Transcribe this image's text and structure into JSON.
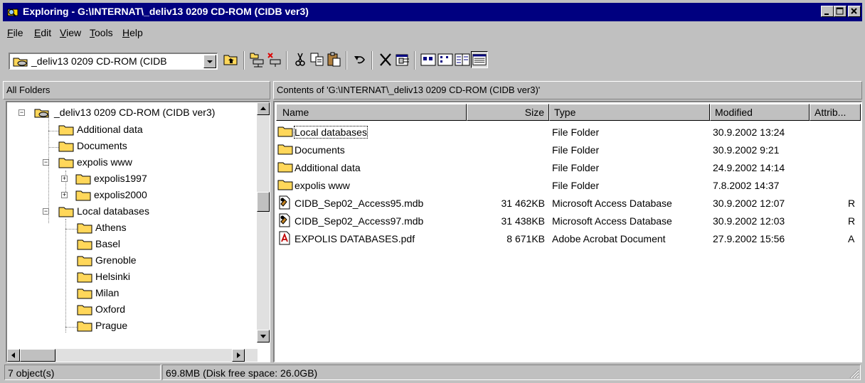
{
  "window": {
    "title": "Exploring - G:\\INTERNAT\\_deliv13 0209 CD-ROM (CIDB ver3)",
    "title_bar_color": "#000080",
    "controls": [
      "minimize-icon",
      "maximize-icon",
      "close-icon"
    ]
  },
  "menu": {
    "items": [
      {
        "label": "File",
        "key": "F",
        "rest": "ile"
      },
      {
        "label": "Edit",
        "key": "E",
        "rest": "dit"
      },
      {
        "label": "View",
        "key": "V",
        "rest": "iew"
      },
      {
        "label": "Tools",
        "key": "T",
        "rest": "ools"
      },
      {
        "label": "Help",
        "key": "H",
        "rest": "elp"
      }
    ]
  },
  "toolbar": {
    "address_value": "_deliv13 0209 CD-ROM (CIDB",
    "buttons": [
      "up-one-level-icon",
      "map-network-drive-icon",
      "disconnect-network-drive-icon",
      "cut-icon",
      "copy-icon",
      "paste-icon",
      "undo-icon",
      "delete-icon",
      "properties-icon",
      "large-icons-view-icon",
      "small-icons-view-icon",
      "list-view-icon",
      "details-view-icon"
    ],
    "active_view": "details-view-icon"
  },
  "left_header": "All Folders",
  "right_header": "Contents of 'G:\\INTERNAT\\_deliv13 0209 CD-ROM (CIDB ver3)'",
  "tree": {
    "root": "_deliv13 0209 CD-ROM (CIDB ver3)",
    "items": [
      {
        "label": "Additional data"
      },
      {
        "label": "Documents"
      },
      {
        "label": "expolis www"
      },
      {
        "label": "expolis1997"
      },
      {
        "label": "expolis2000"
      },
      {
        "label": "Local databases"
      },
      {
        "label": "Athens"
      },
      {
        "label": "Basel"
      },
      {
        "label": "Grenoble"
      },
      {
        "label": "Helsinki"
      },
      {
        "label": "Milan"
      },
      {
        "label": "Oxford"
      },
      {
        "label": "Prague"
      }
    ]
  },
  "list": {
    "columns": {
      "name": "Name",
      "size": "Size",
      "type": "Type",
      "modified": "Modified",
      "attrib": "Attrib..."
    },
    "rows": [
      {
        "icon": "folder-icon",
        "name": "Local databases",
        "size": "",
        "type": "File Folder",
        "modified": "30.9.2002 13:24",
        "attrib": ""
      },
      {
        "icon": "folder-icon",
        "name": "Documents",
        "size": "",
        "type": "File Folder",
        "modified": "30.9.2002 9:21",
        "attrib": ""
      },
      {
        "icon": "folder-icon",
        "name": "Additional data",
        "size": "",
        "type": "File Folder",
        "modified": "24.9.2002 14:14",
        "attrib": ""
      },
      {
        "icon": "folder-icon",
        "name": "expolis www",
        "size": "",
        "type": "File Folder",
        "modified": "7.8.2002 14:37",
        "attrib": ""
      },
      {
        "icon": "access-db-icon",
        "name": "CIDB_Sep02_Access95.mdb",
        "size": "31 462KB",
        "type": "Microsoft Access Database",
        "modified": "30.9.2002 12:07",
        "attrib": "R"
      },
      {
        "icon": "access-db-icon",
        "name": "CIDB_Sep02_Access97.mdb",
        "size": "31 438KB",
        "type": "Microsoft Access Database",
        "modified": "30.9.2002 12:03",
        "attrib": "R"
      },
      {
        "icon": "pdf-icon",
        "name": "EXPOLIS DATABASES.pdf",
        "size": "8 671KB",
        "type": "Adobe Acrobat Document",
        "modified": "27.9.2002 15:56",
        "attrib": "A"
      }
    ]
  },
  "status": {
    "objects": "7 object(s)",
    "disk": "69.8MB (Disk free space: 26.0GB)"
  }
}
